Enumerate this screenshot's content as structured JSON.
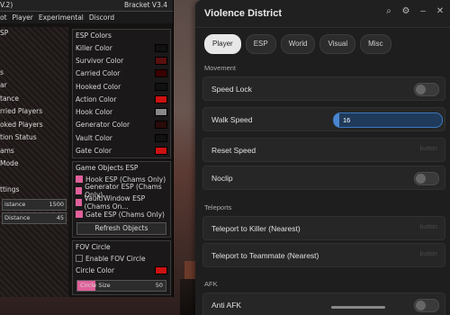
{
  "left_panel": {
    "version": "V.2)",
    "name": "Bracket V3.4",
    "menu": [
      "ot",
      "Player",
      "Experimental",
      "Discord"
    ],
    "left_column": [
      "SP",
      "",
      "",
      "s",
      "ar",
      "tance",
      "rried Players",
      "oked Players",
      "tion Status",
      "ams",
      "Mode",
      "",
      "ttings"
    ],
    "sliders": [
      {
        "label": "istance",
        "value": "1500"
      },
      {
        "label": "Distance",
        "value": "45"
      }
    ],
    "esp_colors_title": "ESP Colors",
    "esp_colors": [
      {
        "label": "Killer Color",
        "color": "#111111"
      },
      {
        "label": "Survivor Color",
        "color": "#5a0f0f"
      },
      {
        "label": "Carried Color",
        "color": "#3a0000"
      },
      {
        "label": "Hooked Color",
        "color": "#111111"
      },
      {
        "label": "Action Color",
        "color": "#cc1111"
      },
      {
        "label": "Hook Color",
        "color": "#888888"
      },
      {
        "label": "Generator Color",
        "color": "#2a0a0a"
      },
      {
        "label": "Vault Color",
        "color": "#111111"
      },
      {
        "label": "Gate Color",
        "color": "#cc1111"
      }
    ],
    "game_objects_title": "Game Objects ESP",
    "game_objects": [
      {
        "label": "Hook ESP (Chams Only)",
        "checked": true
      },
      {
        "label": "Generator ESP (Chams Only)",
        "checked": true
      },
      {
        "label": "Vault/Window ESP (Chams On...",
        "checked": true
      },
      {
        "label": "Gate ESP (Chams Only)",
        "checked": true
      }
    ],
    "refresh_label": "Refresh Objects",
    "fov_title": "FOV Circle",
    "fov_enable": "Enable FOV Circle",
    "circle_color_label": "Circle Color",
    "circle_color": "#cc1111",
    "circle_size_label": "Circle Size",
    "circle_size_value": "50"
  },
  "window": {
    "title": "Violence District",
    "tabs": [
      "Player",
      "ESP",
      "World",
      "Visual",
      "Misc"
    ],
    "active_tab": "Player",
    "sections": {
      "movement": "Movement",
      "teleports": "Teleports",
      "afk": "AFK"
    },
    "speed_lock": "Speed Lock",
    "walk_speed": "Walk Speed",
    "walk_speed_value": "16",
    "reset_speed": "Reset Speed",
    "noclip": "Noclip",
    "teleport_killer": "Teleport to Killer (Nearest)",
    "teleport_teammate": "Teleport to Teammate (Nearest)",
    "anti_afk": "Anti AFK",
    "button_hint": "button"
  }
}
